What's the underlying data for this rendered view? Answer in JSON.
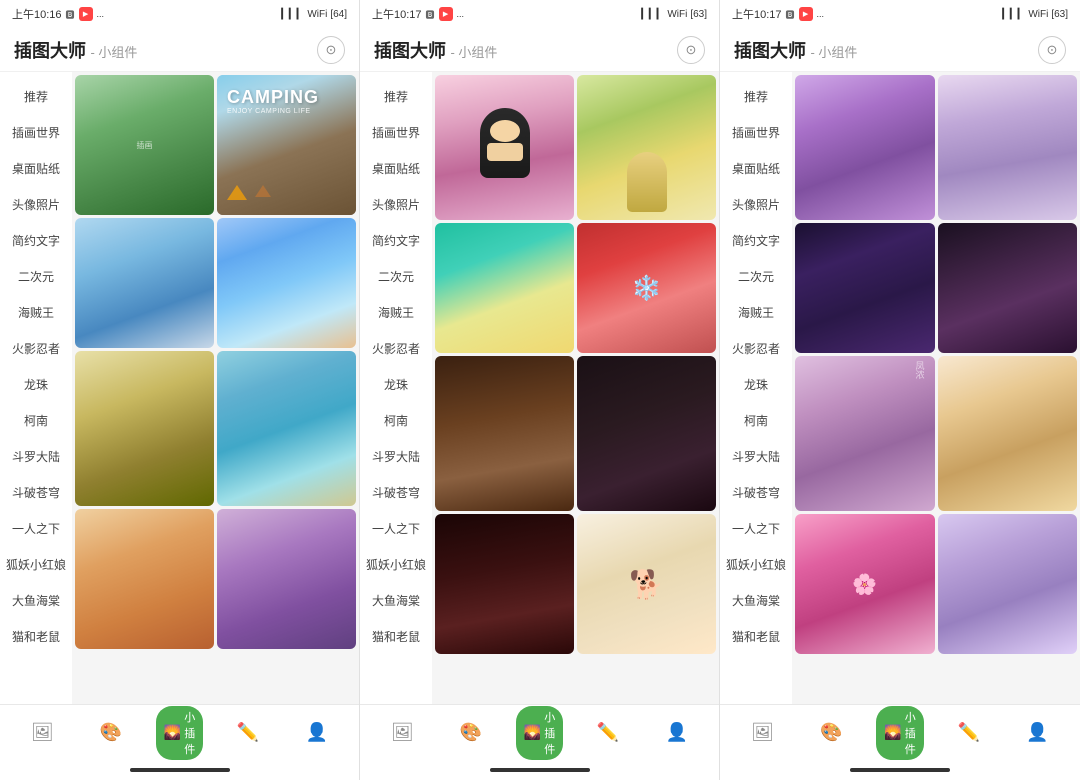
{
  "panels": [
    {
      "id": "panel1",
      "statusBar": {
        "time": "上午10:16",
        "signal": "●●●",
        "wifi": "WiFi",
        "battery": "64"
      },
      "header": {
        "title": "插图大师",
        "subtitle": "- 小组件"
      },
      "sidebar": {
        "items": [
          {
            "label": "推荐",
            "active": false
          },
          {
            "label": "插画世界",
            "active": false
          },
          {
            "label": "桌面贴纸",
            "active": false
          },
          {
            "label": "头像照片",
            "active": false
          },
          {
            "label": "简约文字",
            "active": false
          },
          {
            "label": "二次元",
            "active": false
          },
          {
            "label": "海贼王",
            "active": false
          },
          {
            "label": "火影忍者",
            "active": false
          },
          {
            "label": "龙珠",
            "active": false
          },
          {
            "label": "柯南",
            "active": false
          },
          {
            "label": "斗罗大陆",
            "active": false
          },
          {
            "label": "斗破苍穹",
            "active": false
          },
          {
            "label": "一人之下",
            "active": false
          },
          {
            "label": "狐妖小红娘",
            "active": false
          },
          {
            "label": "大鱼海棠",
            "active": false
          },
          {
            "label": "猫和老鼠",
            "active": false
          }
        ]
      },
      "bottomNav": {
        "items": [
          {
            "icon": "🖼",
            "label": "",
            "active": false
          },
          {
            "icon": "🎨",
            "label": "",
            "active": false
          },
          {
            "icon": "🌄",
            "label": "小插件",
            "active": true
          },
          {
            "icon": "✏️",
            "label": "",
            "active": false
          },
          {
            "icon": "👤",
            "label": "",
            "active": false
          }
        ]
      }
    },
    {
      "id": "panel2",
      "statusBar": {
        "time": "上午10:17",
        "signal": "●●●",
        "wifi": "WiFi",
        "battery": "63"
      },
      "header": {
        "title": "插图大师",
        "subtitle": "- 小组件"
      },
      "sidebar": {
        "items": [
          {
            "label": "推荐",
            "active": false
          },
          {
            "label": "插画世界",
            "active": false
          },
          {
            "label": "桌面贴纸",
            "active": false
          },
          {
            "label": "头像照片",
            "active": false
          },
          {
            "label": "简约文字",
            "active": false
          },
          {
            "label": "二次元",
            "active": false
          },
          {
            "label": "海贼王",
            "active": false
          },
          {
            "label": "火影忍者",
            "active": false
          },
          {
            "label": "龙珠",
            "active": false
          },
          {
            "label": "柯南",
            "active": false
          },
          {
            "label": "斗罗大陆",
            "active": false
          },
          {
            "label": "斗破苍穹",
            "active": false
          },
          {
            "label": "一人之下",
            "active": false
          },
          {
            "label": "狐妖小红娘",
            "active": false
          },
          {
            "label": "大鱼海棠",
            "active": false
          },
          {
            "label": "猫和老鼠",
            "active": false
          }
        ]
      }
    },
    {
      "id": "panel3",
      "statusBar": {
        "time": "上午10:17",
        "signal": "●●●",
        "wifi": "WiFi",
        "battery": "63"
      },
      "header": {
        "title": "插图大师",
        "subtitle": "- 小组件"
      },
      "sidebar": {
        "items": [
          {
            "label": "推荐",
            "active": false
          },
          {
            "label": "插画世界",
            "active": false
          },
          {
            "label": "桌面贴纸",
            "active": false
          },
          {
            "label": "头像照片",
            "active": false
          },
          {
            "label": "简约文字",
            "active": false
          },
          {
            "label": "二次元",
            "active": false
          },
          {
            "label": "海贼王",
            "active": false
          },
          {
            "label": "火影忍者",
            "active": false
          },
          {
            "label": "龙珠",
            "active": false
          },
          {
            "label": "柯南",
            "active": false
          },
          {
            "label": "斗罗大陆",
            "active": false
          },
          {
            "label": "斗破苍穹",
            "active": false
          },
          {
            "label": "一人之下",
            "active": false
          },
          {
            "label": "狐妖小红娘",
            "active": false
          },
          {
            "label": "大鱼海棠",
            "active": false
          },
          {
            "label": "猫和老鼠",
            "active": false
          }
        ]
      }
    }
  ],
  "bottomNav": {
    "items": [
      {
        "icon": "🖼",
        "label": ""
      },
      {
        "icon": "🎨",
        "label": ""
      },
      {
        "icon": "🌄",
        "label": "小插件"
      },
      {
        "icon": "✏️",
        "label": ""
      },
      {
        "icon": "👤",
        "label": ""
      }
    ]
  }
}
